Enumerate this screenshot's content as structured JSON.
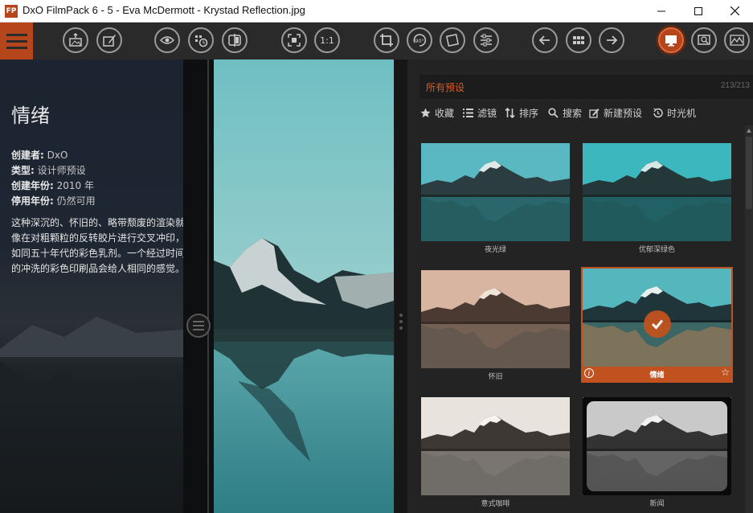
{
  "window": {
    "logo_text": "FP",
    "title": "DxO FilmPack 6 - 5 - Eva McDermott - Krystad Reflection.jpg"
  },
  "toolbar": {
    "buttons": [
      "open-image-icon",
      "edit-image-icon",
      "eye-icon",
      "compare-history-icon",
      "split-view-icon",
      "fit-screen-icon",
      "zoom-1-1-icon",
      "crop-icon",
      "rotate-90-icon",
      "straighten-icon",
      "adjustments-icon",
      "previous-icon",
      "grid-icon",
      "next-icon",
      "presets-view-icon",
      "loupe-icon",
      "histogram-icon"
    ],
    "zoom_label": "1:1",
    "rotate_label": "90°"
  },
  "info_panel": {
    "title": "情绪",
    "creator_label": "创建者:",
    "creator_value": "DxO",
    "type_label": "类型:",
    "type_value": "设计师预设",
    "year_label": "创建年份:",
    "year_value": "2010 年",
    "discontinued_label": "停用年份:",
    "discontinued_value": "仍然可用",
    "description": "这种深沉的、怀旧的、略带颓废的渲染就像在对粗颗粒的反转胶片进行交叉冲印，如同五十年代的彩色乳剂。一个经过时间的冲洗的彩色印刷品会给人相同的感觉。"
  },
  "presets": {
    "header_title": "所有预设",
    "count": "213/213",
    "filters": [
      "收藏",
      "滤镜",
      "排序",
      "搜索",
      "新建预设",
      "时光机"
    ],
    "thumbnails": [
      {
        "caption": "夜光绿"
      },
      {
        "caption": "优郁深绿色"
      },
      {
        "caption": "怀旧"
      },
      {
        "caption": "情绪",
        "selected": true
      },
      {
        "caption": "意式咖啡"
      },
      {
        "caption": "新闻"
      }
    ]
  },
  "colors": {
    "accent": "#c1521f",
    "toolbar_bg": "#2a2a2a",
    "panel_bg": "#232323"
  }
}
